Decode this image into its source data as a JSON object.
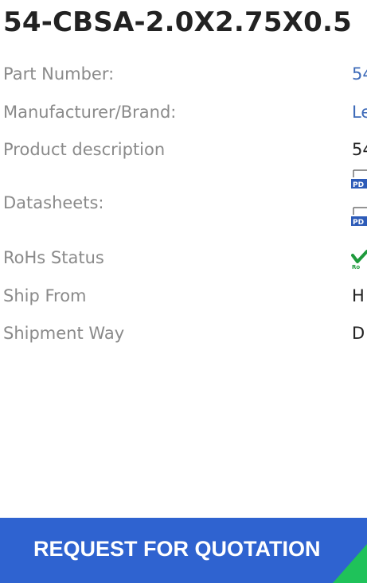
{
  "product": {
    "title": "54-CBSA-2.0X2.75X0.5"
  },
  "specs": {
    "part_number": {
      "label": "Part Number:",
      "value": "54"
    },
    "manufacturer": {
      "label": "Manufacturer/Brand:",
      "value": "Le"
    },
    "description": {
      "label": "Product description",
      "value": "54"
    },
    "datasheets": {
      "label": "Datasheets:",
      "icon": "pdf-icon"
    },
    "rohs": {
      "label": "RoHs Status",
      "icon": "rohs-compliant-icon"
    },
    "ship_from": {
      "label": "Ship From",
      "value": "H"
    },
    "shipment_way": {
      "label": "Shipment Way",
      "value": "D"
    }
  },
  "actions": {
    "request_quotation": "REQUEST FOR QUOTATION"
  },
  "colors": {
    "title": "#222222",
    "label": "#8a8a8a",
    "link": "#3d6ab8",
    "button": "#2f63d0",
    "accent": "#1fc25a"
  }
}
